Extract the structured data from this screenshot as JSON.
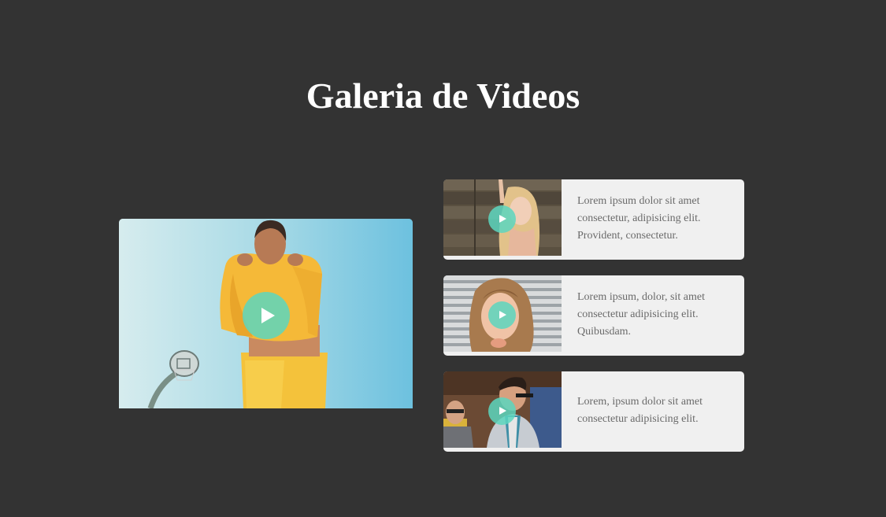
{
  "page": {
    "title": "Galeria de Videos"
  },
  "main_video": {
    "play_icon": "play-icon"
  },
  "videos": [
    {
      "description": "Lorem ipsum dolor sit amet consectetur, adipisicing elit. Provident, consectetur.",
      "play_icon": "play-icon"
    },
    {
      "description": "Lorem ipsum, dolor, sit amet consectetur adipisicing elit. Quibusdam.",
      "play_icon": "play-icon"
    },
    {
      "description": "Lorem, ipsum dolor sit amet consectetur adipisicing elit.",
      "play_icon": "play-icon"
    }
  ],
  "colors": {
    "background": "#333333",
    "card": "#f0f0f0",
    "play_button": "#5cd6be",
    "title": "#ffffff",
    "card_text": "#6a6a6a"
  }
}
